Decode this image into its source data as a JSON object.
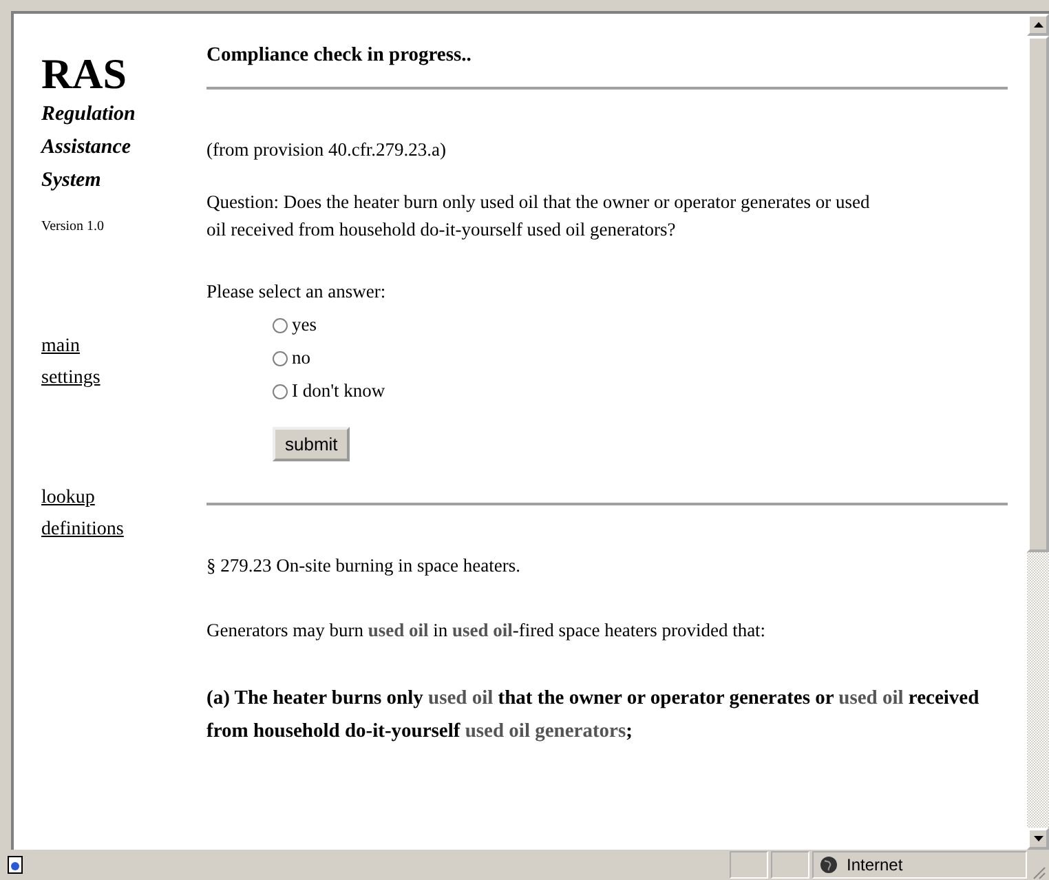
{
  "sidebar": {
    "logo": "RAS",
    "subtitle": "Regulation Assistance System",
    "version": "Version 1.0",
    "link_groups": [
      [
        "main",
        "settings"
      ],
      [
        "lookup",
        "definitions"
      ]
    ]
  },
  "main": {
    "heading": "Compliance check in progress..",
    "provision": "(from provision 40.cfr.279.23.a)",
    "question": "Question: Does the heater burn only used oil that the owner or operator generates or used oil received from household do-it-yourself used oil generators?",
    "prompt": "Please select an answer:",
    "options": [
      {
        "label": "yes",
        "selected": false
      },
      {
        "label": "no",
        "selected": false
      },
      {
        "label": "I don't know",
        "selected": false
      }
    ],
    "submit": "submit",
    "section_title": "§ 279.23 On-site burning in space heaters.",
    "paragraphs": [
      {
        "kind": "normal",
        "segments": [
          {
            "kind": "plain",
            "text": "Generators may burn "
          },
          {
            "kind": "term",
            "text": "used oil"
          },
          {
            "kind": "plain",
            "text": " in "
          },
          {
            "kind": "term",
            "text": "used oil"
          },
          {
            "kind": "plain",
            "text": "-fired space heaters provided that:"
          }
        ]
      },
      {
        "kind": "bold",
        "segments": [
          {
            "kind": "plain",
            "text": "(a) The heater burns only "
          },
          {
            "kind": "term",
            "text": "used oil"
          },
          {
            "kind": "plain",
            "text": " that the owner or operator generates or "
          },
          {
            "kind": "term",
            "text": "used oil"
          },
          {
            "kind": "plain",
            "text": " received from household do-it-yourself "
          },
          {
            "kind": "term",
            "text": "used oil generators"
          },
          {
            "kind": "plain",
            "text": ";"
          }
        ]
      }
    ]
  },
  "status_bar": {
    "zone": "Internet"
  }
}
